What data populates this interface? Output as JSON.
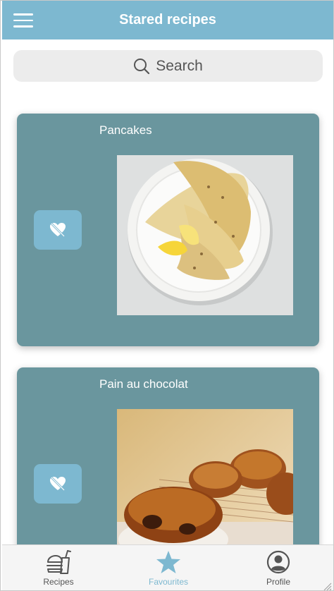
{
  "header": {
    "title": "Stared recipes",
    "menu_icon": "hamburger-menu-icon"
  },
  "search": {
    "label": "Search",
    "icon": "search-icon"
  },
  "recipes": [
    {
      "title": "Pancakes",
      "action_icon": "heart-slash-icon"
    },
    {
      "title": "Pain au chocolat",
      "action_icon": "heart-slash-icon"
    }
  ],
  "tabs": [
    {
      "label": "Recipes",
      "icon": "burger-drink-icon",
      "active": false
    },
    {
      "label": "Favourites",
      "icon": "star-icon",
      "active": true
    },
    {
      "label": "Profile",
      "icon": "user-circle-icon",
      "active": false
    }
  ],
  "colors": {
    "header": "#7db8d0",
    "card": "#6a969e",
    "accent": "#7db8d0",
    "search_bg": "#ececec"
  }
}
